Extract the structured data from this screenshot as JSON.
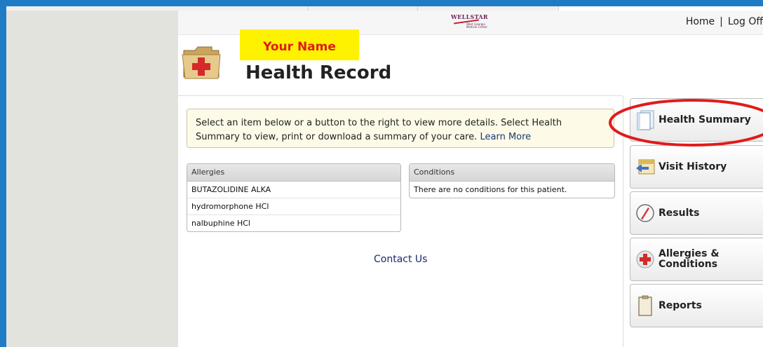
{
  "header": {
    "logo_text": "WELLSTAR",
    "logo_sub": "West Georgia Medical Center",
    "links": [
      "Home",
      "Log Off"
    ],
    "separator": "|"
  },
  "page": {
    "name_highlight": "Your Name",
    "title": "Health Record"
  },
  "info": {
    "text": "Select an item below or a button to the right to view more details. Select Health Summary to view, print or download a summary of your care.",
    "link": "Learn More"
  },
  "allergies": {
    "header": "Allergies",
    "rows": [
      "BUTAZOLIDINE ALKA",
      "hydromorphone HCl",
      "nalbuphine HCl"
    ]
  },
  "conditions": {
    "header": "Conditions",
    "rows": [
      "There are no conditions for this patient."
    ]
  },
  "footer": {
    "contact": "Contact Us"
  },
  "sidebar": {
    "items": [
      {
        "label": "Health Summary",
        "icon": "document-icon"
      },
      {
        "label": "Visit History",
        "icon": "visit-history-icon"
      },
      {
        "label": "Results",
        "icon": "results-icon"
      },
      {
        "label": "Allergies & Conditions",
        "icon": "red-cross-icon"
      },
      {
        "label": "Reports",
        "icon": "clipboard-icon"
      }
    ]
  },
  "colors": {
    "frame": "#1f7bc6",
    "highlight": "#fff200",
    "annotation": "#e01b1b",
    "link": "#1a3a7a"
  }
}
